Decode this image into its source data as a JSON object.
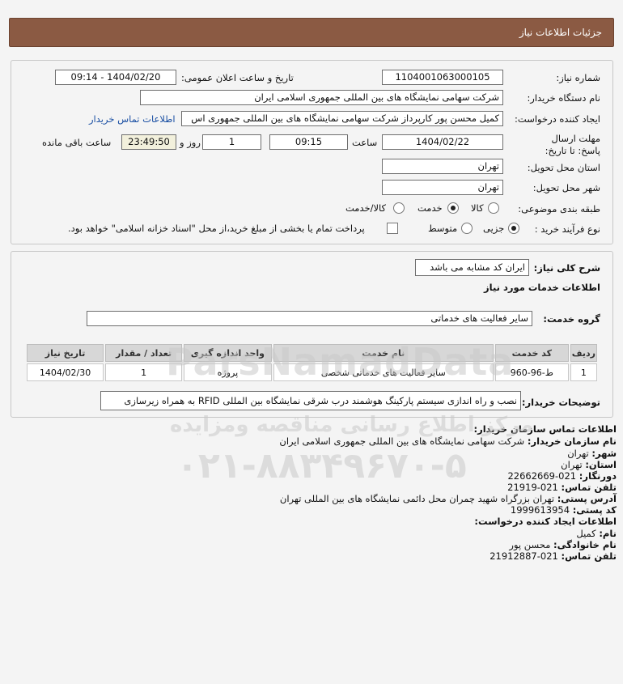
{
  "header": {
    "title": "جزئیات اطلاعات نیاز"
  },
  "form": {
    "need_number_label": "شماره نیاز:",
    "need_number": "1104001063000105",
    "announce_label": "تاریخ و ساعت اعلان عمومی:",
    "announce_value": "1404/02/20 - 09:14",
    "buyer_org_label": "نام دستگاه خریدار:",
    "buyer_org": "شرکت سهامی نمایشگاه های بین المللی جمهوری اسلامی ایران",
    "creator_label": "ایجاد کننده درخواست:",
    "creator": "کمیل محسن پور کارپرداز شرکت سهامی نمایشگاه های بین المللی جمهوری اس",
    "contact_link": "اطلاعات تماس خریدار",
    "deadline_label": "مهلت ارسال پاسخ: تا تاریخ:",
    "deadline_date": "1404/02/22",
    "time_label": "ساعت",
    "deadline_time": "09:15",
    "days_value": "1",
    "days_label": "روز و",
    "remaining_time": "23:49:50",
    "remaining_label": "ساعت باقی مانده",
    "province_label": "استان محل تحویل:",
    "province": "تهران",
    "city_label": "شهر محل تحویل:",
    "city": "تهران",
    "category_label": "طبقه بندی موضوعی:",
    "category_options": [
      "کالا",
      "خدمت",
      "کالا/خدمت"
    ],
    "category_selected": "خدمت",
    "process_label": "نوع فرآیند خرید :",
    "process_options": [
      "جزیی",
      "متوسط"
    ],
    "process_selected": "جزیی",
    "payment_note": "پرداخت تمام یا بخشی از مبلغ خرید،از محل \"اسناد خزانه اسلامی\" خواهد بود."
  },
  "summary": {
    "general_desc_label": "شرح کلی نیاز:",
    "general_desc": "ایران کد مشابه می باشد",
    "services_title": "اطلاعات خدمات مورد نیاز",
    "service_group_label": "گروه خدمت:",
    "service_group": "سایر فعالیت های خدماتی",
    "table": {
      "headers": [
        "ردیف",
        "کد خدمت",
        "نام خدمت",
        "واحد اندازه گیری",
        "تعداد / مقدار",
        "تاریخ نیاز"
      ],
      "rows": [
        [
          "1",
          "ط-96-960",
          "سایر فعالیت های خدماتی شخصی",
          "پروژه",
          "1",
          "1404/02/30"
        ]
      ]
    },
    "buyer_notes_label": "توضیحات خریدار:",
    "buyer_notes": "نصب و راه اندازی سیستم پارکینگ هوشمند درب شرقی نمایشگاه بین المللی RFID به همراه زیرسازی"
  },
  "contact": {
    "title": "اطلاعات تماس سازمان خریدار:",
    "org_label": "نام سازمان خریدار:",
    "org": "شرکت سهامی نمایشگاه های بین المللی جمهوری اسلامی ایران",
    "city_label": "شهر:",
    "city": "تهران",
    "province_label": "استان:",
    "province": "تهران",
    "fax_label": "دورنگار:",
    "fax": "021-22662669",
    "phone_label": "تلفن تماس:",
    "phone": "021-21919",
    "address_label": "آدرس پستی:",
    "address": "تهران بزرگراه شهید چمران محل دائمی نمایشگاه های بین المللی تهران",
    "postal_label": "کد پستی:",
    "postal": "1999613954",
    "creator_title": "اطلاعات ایجاد کننده درخواست:",
    "name_label": "نام:",
    "name": "کمیل",
    "family_label": "نام خانوادگی:",
    "family": "محسن پور",
    "creator_phone_label": "تلفن تماس:",
    "creator_phone": "021-21912887"
  },
  "watermark": {
    "line1": "ParsNamadData",
    "line2": "مرکز اطلاع رسانی مناقصه ومزایده",
    "line3": "۰۲۱-۸۸۳۴۹۶۷۰-۵"
  }
}
